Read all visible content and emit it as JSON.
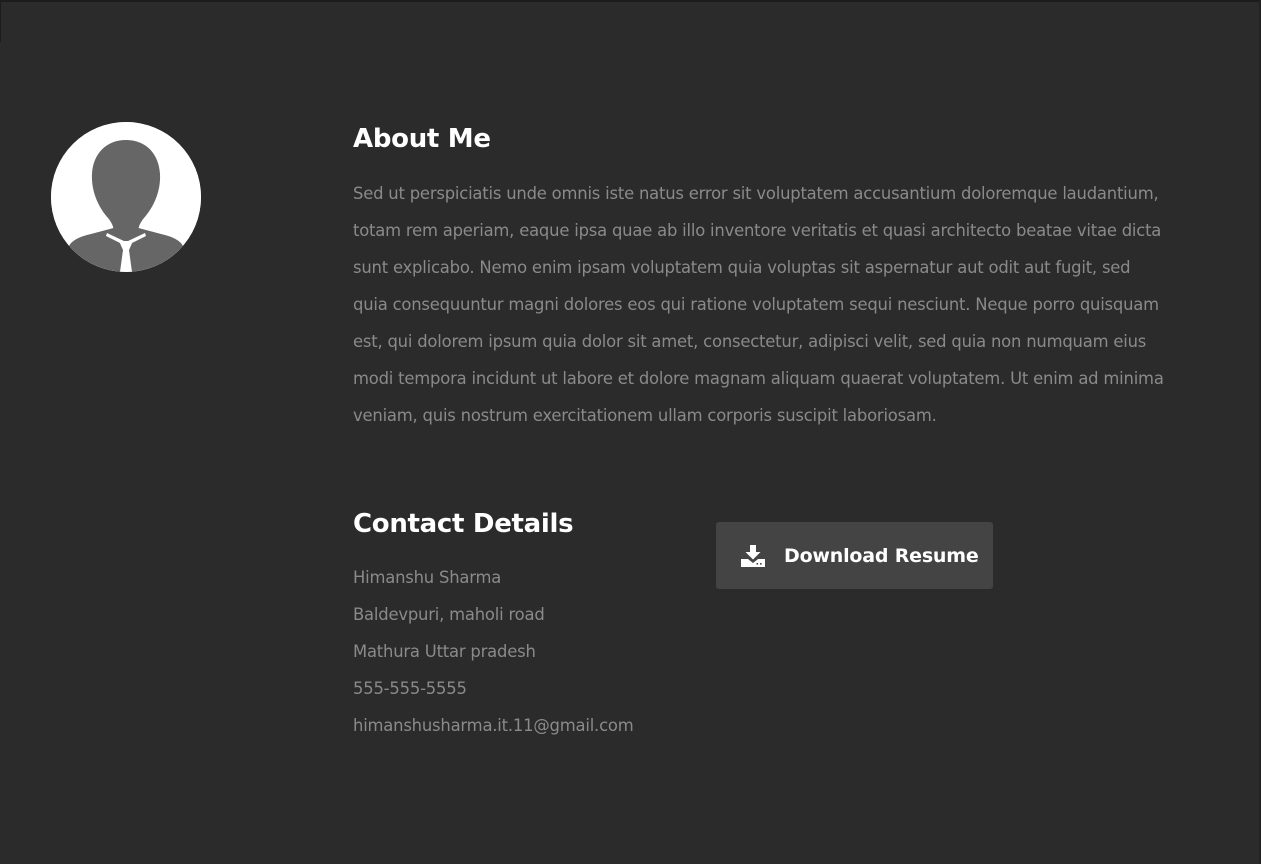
{
  "about": {
    "title": "About Me",
    "text": "Sed ut perspiciatis unde omnis iste natus error sit voluptatem accusantium doloremque laudantium, totam rem aperiam, eaque ipsa quae ab illo inventore veritatis et quasi architecto beatae vitae dicta sunt explicabo. Nemo enim ipsam voluptatem quia voluptas sit aspernatur aut odit aut fugit, sed quia consequuntur magni dolores eos qui ratione voluptatem sequi nesciunt. Neque porro quisquam est, qui dolorem ipsum quia dolor sit amet, consectetur, adipisci velit, sed quia non numquam eius modi tempora incidunt ut labore et dolore magnam aliquam quaerat voluptatem. Ut enim ad minima veniam, quis nostrum exercitationem ullam corporis suscipit laboriosam."
  },
  "contact": {
    "title": "Contact Details",
    "name": "Himanshu Sharma",
    "address_line1": "Baldevpuri, maholi road",
    "address_line2": "Mathura Uttar pradesh",
    "phone": "555-555-5555",
    "email": "himanshusharma.it.11@gmail.com"
  },
  "download": {
    "label": "Download Resume",
    "icon": "download-icon"
  },
  "avatar": {
    "icon": "user-silhouette-icon"
  },
  "colors": {
    "background": "#2b2b2b",
    "heading": "#ffffff",
    "body_text": "#8a8a8a",
    "button_bg": "#444444"
  }
}
